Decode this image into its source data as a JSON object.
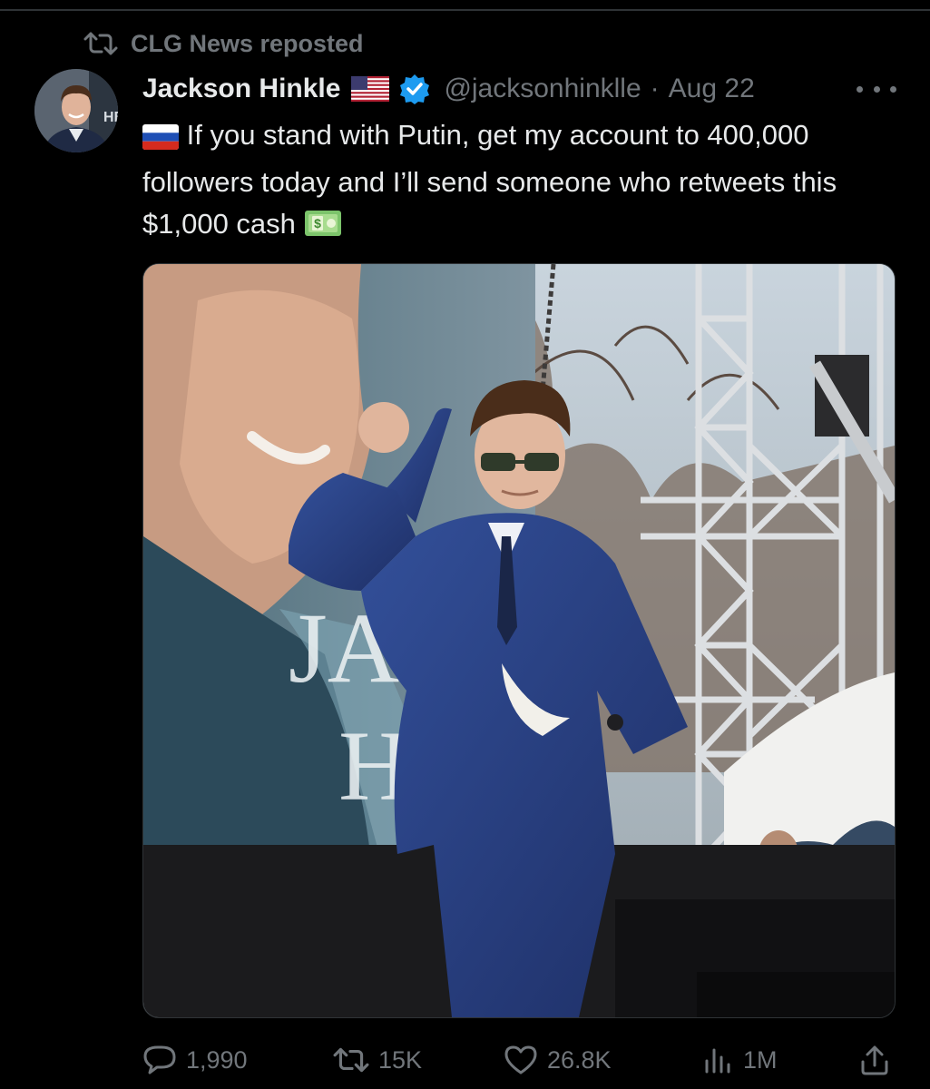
{
  "repost": {
    "text": "CLG News reposted",
    "icon": "repost-icon"
  },
  "author": {
    "name": "Jackson Hinkle",
    "handle": "@jacksonhinklle",
    "separator": "·",
    "date": "Aug 22",
    "flag": "us-flag-icon",
    "badge": "verified-badge-icon",
    "avatar_text": "HB"
  },
  "tweet": {
    "text": "If you stand with Putin, get my account to 400,000 followers today and I’ll send someone who retweets this $1,000 cash",
    "leading_emoji": "russia-flag-icon",
    "trailing_emoji": "dollar-banknote-icon"
  },
  "media": {
    "banner_text_1": "JACK",
    "banner_text_2": "HI"
  },
  "actions": {
    "replies": "1,990",
    "reposts": "15K",
    "likes": "26.8K",
    "views": "1M"
  },
  "colors": {
    "background": "#000000",
    "text": "#e7e9ea",
    "muted": "#71767b",
    "verified": "#1d9bf0",
    "divider": "#2f3336"
  }
}
